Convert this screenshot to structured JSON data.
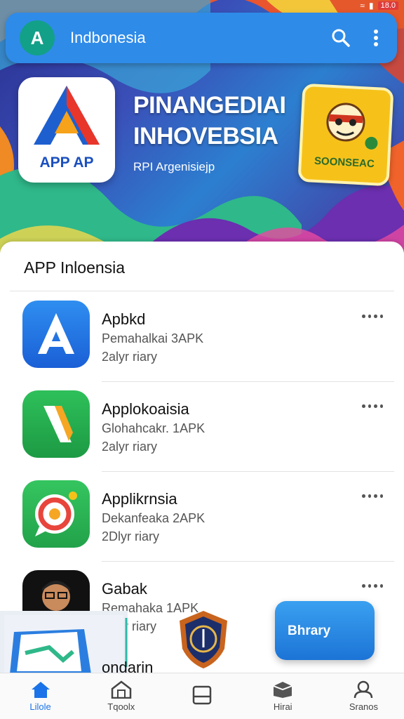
{
  "status_bar": {
    "battery": "18.0"
  },
  "search_bar": {
    "logo_letter": "A",
    "title": "Indbonesia"
  },
  "hero": {
    "title_line1": "PINANGEDIAI",
    "title_line2": "INHOVEBSIA",
    "subtitle": "RPI Argenisiejp",
    "app_tile_label": "APP AP",
    "game_tile_label": "SOONSEAC"
  },
  "section": {
    "title": "APP Inloensia"
  },
  "apps": [
    {
      "name": "Apbkd",
      "meta": "Pemahalkai 3APK",
      "sub": "2alyr riary",
      "icon": "letter-a-icon"
    },
    {
      "name": "Applokoaisia",
      "meta": "Glohahcakr. 1APK",
      "sub": "2alyr riary",
      "icon": "slash-icon"
    },
    {
      "name": "Applikrnsia",
      "meta": "Dekanfeaka 2APK",
      "sub": "2Dlyr riary",
      "icon": "camera-bubble-icon"
    },
    {
      "name": "Gabak",
      "meta": "Remahaka 1APK",
      "sub": "29Pr riary",
      "icon": "avatar-icon"
    }
  ],
  "overlay": {
    "promo_label": "Bhrary",
    "partial_name": "ondarin"
  },
  "nav": [
    {
      "label": "Lilole",
      "icon": "home-icon",
      "active": true
    },
    {
      "label": "Tqoolx",
      "icon": "store-icon",
      "active": false
    },
    {
      "label": "",
      "icon": "window-icon",
      "active": false
    },
    {
      "label": "Hirai",
      "icon": "box-icon",
      "active": false
    },
    {
      "label": "Sranos",
      "icon": "user-icon",
      "active": false
    }
  ],
  "colors": {
    "accent": "#2f8be8",
    "nav_active": "#1a73e8",
    "game_tile": "#f6c21a"
  }
}
